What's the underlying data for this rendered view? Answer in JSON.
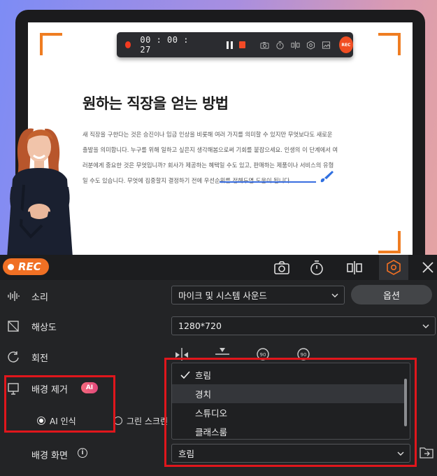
{
  "recording_toolbar": {
    "timer": "00 : 00 : 27",
    "rec_label": "REC",
    "icons": [
      "camera-icon",
      "timer-icon",
      "split-icon",
      "settings-icon",
      "screenshot-icon"
    ]
  },
  "document": {
    "title": "원하는 직장을 얻는 방법",
    "lines": [
      "새 직장을 구한다는 것은 승진이나 임금 인상을 비롯해 여러 가지를 의미할 수 있지만 무엇보다도 새로운",
      "출발을 의미합니다. 누구를 위해 일하고 싶은지 생각해봄으로써 기회를 붙잡으세요. 인생의 이 단계에서 여",
      "러분에게 중요한 것은 무엇입니까? 회사가 제공하는 혜택일 수도 있고, 판매하는 제품이나 서비스의 유형",
      "일 수도 있습니다. 무엇에 집중할지 결정하기 전에 우선순위를 정해두면 도움이 됩니다."
    ]
  },
  "panel": {
    "rec_badge": "REC",
    "sound": {
      "label": "소리",
      "value": "마이크 및 시스템 사운드",
      "options_button": "옵션"
    },
    "resolution": {
      "label": "해상도",
      "value": "1280*720"
    },
    "rotation": {
      "label": "회전"
    },
    "bg_removal": {
      "label": "배경 제거",
      "badge": "AI",
      "ai_option": "AI 인식",
      "green_option": "그린 스크린"
    },
    "bg_screen": {
      "label": "배경 화면",
      "info": "i",
      "value": "흐림",
      "options": [
        "흐림",
        "경치",
        "스튜디오",
        "클래스룸"
      ],
      "selected_index": 0,
      "hovered_index": 1
    }
  },
  "colors": {
    "accent_orange": "#f07024",
    "highlight_red": "#e0161c",
    "panel_bg": "#232426"
  }
}
